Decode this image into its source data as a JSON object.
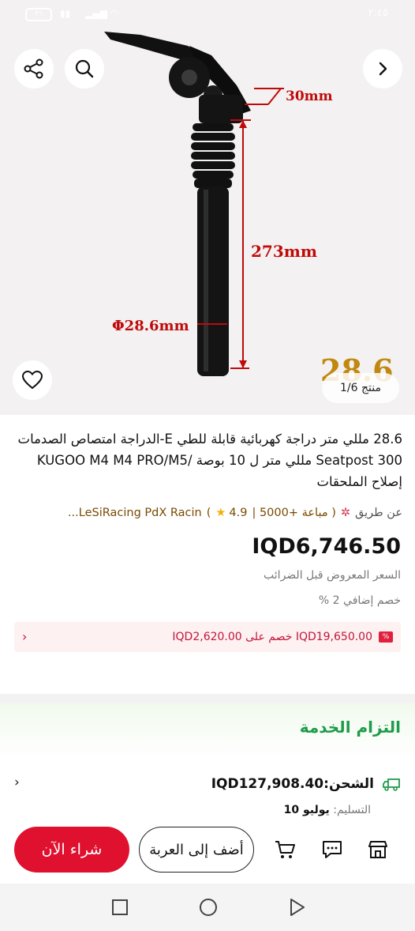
{
  "status_bar": {
    "battery": "٣٦",
    "time": "٢:٤٥"
  },
  "product_image": {
    "measure_top": "30mm",
    "measure_length": "273mm",
    "measure_diameter": "Φ28.6mm",
    "corner_text": "28.6",
    "counter": "منتج 1/6"
  },
  "title": "28.6 مللي متر دراجة كهربائية قابلة للطي E-الدراجة امتصاص الصدمات Seatpost 300 مللي متر ل 10 بوصة /KUGOO M4 M4 PRO/M5 إصلاح الملحقات",
  "seller": {
    "prefix": "عن طريق",
    "rating": "4.9",
    "sold": "( مباعة +5000 |",
    "store": "LeSiRacing PdX Racin..."
  },
  "price": {
    "amount": "IQD6,746.50",
    "note": "السعر المعروض قبل الضرائب",
    "extra_discount": "خصم إضافي 2 %"
  },
  "coupon": {
    "text": "IQD19,650.00 خصم على IQD2,620.00"
  },
  "service": {
    "title": "التزام الخدمة"
  },
  "shipping": {
    "label": "الشحن:IQD127,908.40",
    "delivery_label": "التسليم:",
    "delivery_date": "يوليو 10"
  },
  "actions": {
    "buy_now": "شراء الآن",
    "add_to_cart": "أضف إلى العربة"
  },
  "colors": {
    "accent_red": "#e0102f",
    "service_green": "#1e9c4a",
    "measure_red": "#c00a0a"
  }
}
